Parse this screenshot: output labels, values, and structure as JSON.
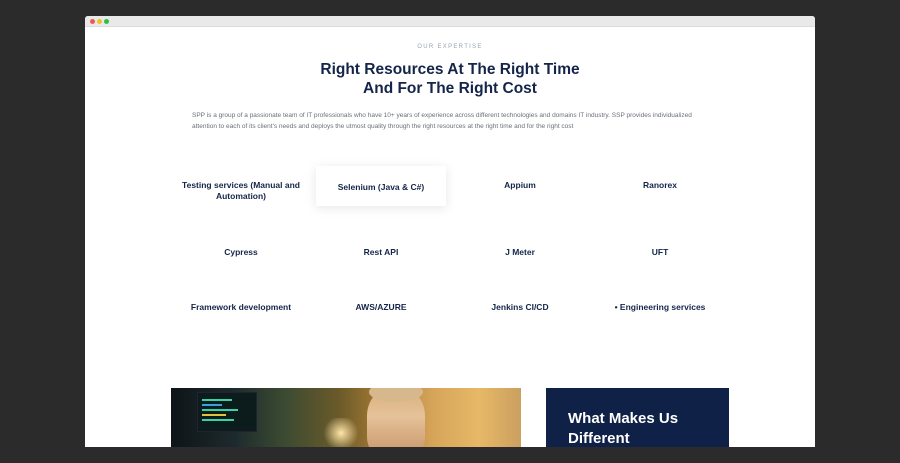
{
  "section": {
    "eyebrow": "OUR EXPERTISE",
    "heading_line1": "Right Resources At The Right Time",
    "heading_line2": "And For The Right Cost",
    "intro": "SPP is a group of a passionate team of IT professionals who have 10+ years of experience across different technologies and domains IT industry. SSP provides individualized attention to each of its client's needs and deploys the utmost quality through the right resources at the right time and for the right cost"
  },
  "services": [
    "Testing services (Manual and Automation)",
    "Selenium (Java & C#)",
    "Appium",
    "Ranorex",
    "Cypress",
    "Rest API",
    "J Meter",
    "UFT",
    "Framework development",
    "AWS/AZURE",
    "Jenkins CI/CD",
    "• Engineering services"
  ],
  "featured_service_index": 1,
  "diff_panel": {
    "title_line1": "What Makes Us",
    "title_line2": "Different"
  },
  "colors": {
    "navy": "#14254a",
    "panel_bg": "#0f2147",
    "page_bg": "#2b2b2b"
  }
}
